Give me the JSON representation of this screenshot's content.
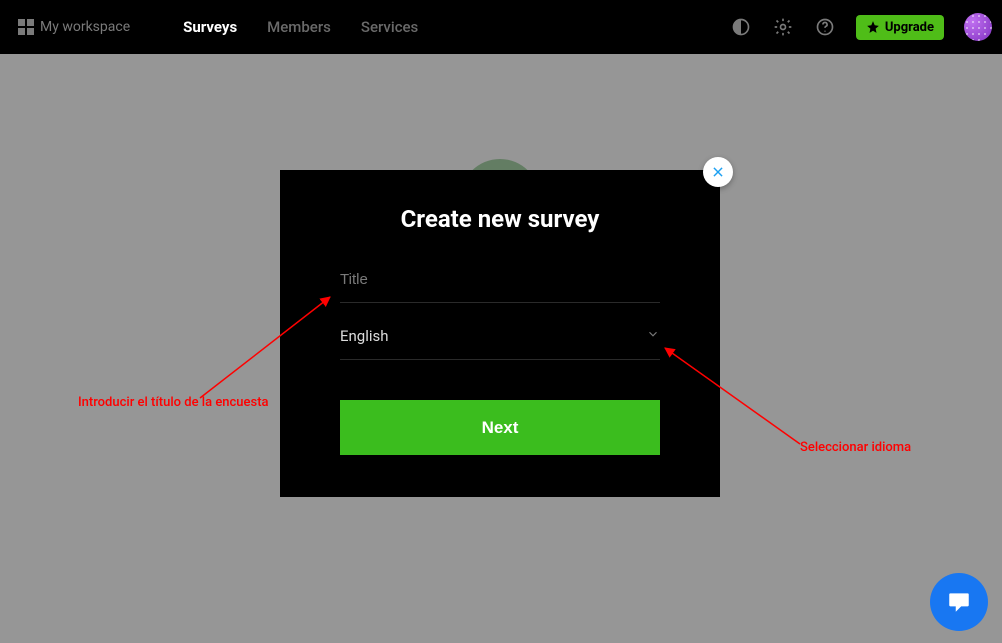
{
  "header": {
    "workspace_label": "My workspace",
    "nav": {
      "surveys": "Surveys",
      "members": "Members",
      "services": "Services"
    },
    "upgrade_label": "Upgrade"
  },
  "modal": {
    "title": "Create new survey",
    "title_placeholder": "Title",
    "language_value": "English",
    "next_label": "Next"
  },
  "annotations": {
    "left": "Introducir el título de la encuesta",
    "right": "Seleccionar idioma"
  }
}
